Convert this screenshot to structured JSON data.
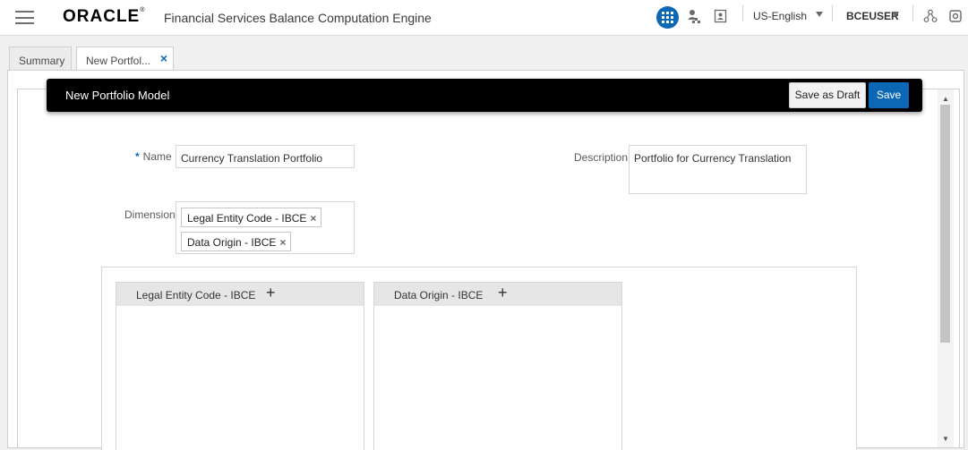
{
  "header": {
    "logo_text": "ORACLE",
    "logo_mark": "®",
    "app_title": "Financial Services Balance Computation Engine",
    "language": "US-English",
    "user": "BCEUSER",
    "icons": [
      "apps-grid-icon",
      "user-hierarchy-icon",
      "contact-card-icon",
      "sitemap-icon",
      "logout-icon"
    ]
  },
  "tabs": [
    {
      "label": "Summary"
    },
    {
      "label": "New Portfol...",
      "close": "×"
    }
  ],
  "toolbar": {
    "title": "New Portfolio Model",
    "save_draft_label": "Save as Draft",
    "save_label": "Save"
  },
  "form": {
    "name_required_mark": "*",
    "name_label": "Name",
    "name_value": "Currency Translation Portfolio",
    "description_label": "Description",
    "description_value": "Portfolio for Currency Translation",
    "dimension_label": "Dimension",
    "dimension_chips": [
      {
        "label": "Legal Entity Code - IBCE",
        "remove": "×"
      },
      {
        "label": "Data Origin - IBCE",
        "remove": "×"
      }
    ]
  },
  "panels": [
    {
      "title": "Legal Entity Code - IBCE",
      "add": "+"
    },
    {
      "title": "Data Origin - IBCE",
      "add": "+"
    }
  ],
  "scrollbar": {
    "up": "▲",
    "down": "▼"
  },
  "colors": {
    "accent": "#0c67b5",
    "toolbar_bg": "#000000",
    "panel_header": "#e6e6e6"
  }
}
